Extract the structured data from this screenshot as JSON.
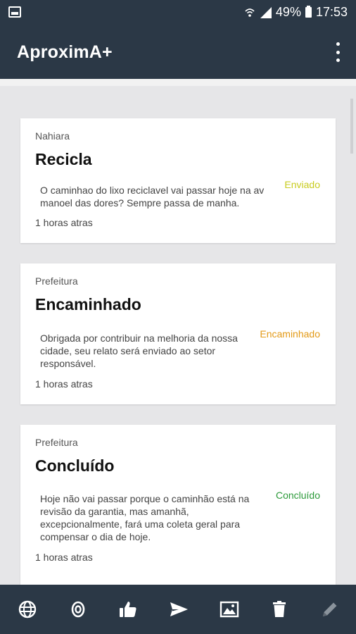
{
  "status_bar": {
    "battery": "49%",
    "time": "17:53"
  },
  "app_bar": {
    "title": "AproximA+"
  },
  "cards": [
    {
      "author": "Nahiara",
      "title": "Recicla",
      "message": "O caminhao do lixo reciclavel vai passar hoje na av manoel das dores? Sempre passa de manha.",
      "status": "Enviado",
      "status_color": "#c8cc1e",
      "time": "1 horas atras"
    },
    {
      "author": "Prefeitura",
      "title": "Encaminhado",
      "message": "Obrigada por contribuir na melhoria da nossa cidade, seu relato será enviado ao setor responsável.",
      "status": "Encaminhado",
      "status_color": "#e39a17",
      "time": "1 horas atras"
    },
    {
      "author": "Prefeitura",
      "title": "Concluído",
      "message": "Hoje não vai passar porque o caminhão está na revisão da garantia, mas amanhã, excepcionalmente, fará uma coleta geral para compensar o dia de hoje.",
      "status": "Concluído",
      "status_color": "#2c9a3a",
      "time": "1 horas atras"
    }
  ],
  "bottom_nav": {
    "icons": [
      "globe-icon",
      "target-icon",
      "thumbs-up-icon",
      "send-icon",
      "image-icon",
      "trash-icon",
      "pencil-icon"
    ]
  }
}
